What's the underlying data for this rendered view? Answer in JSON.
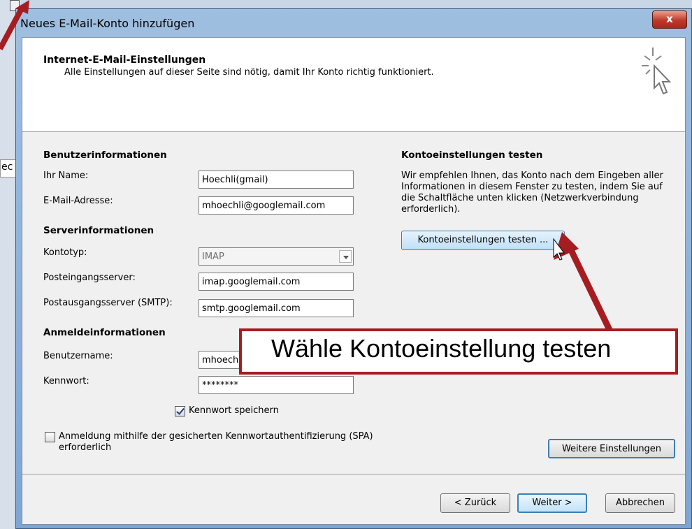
{
  "window": {
    "title": "Neues E-Mail-Konto hinzufügen",
    "close_label": "x"
  },
  "header": {
    "title": "Internet-E-Mail-Einstellungen",
    "subtitle": "Alle Einstellungen auf dieser Seite sind nötig, damit Ihr Konto richtig funktioniert."
  },
  "user": {
    "heading": "Benutzerinformationen",
    "name_label": "Ihr Name:",
    "name_value": "Hoechli(gmail)",
    "email_label": "E-Mail-Adresse:",
    "email_value": "mhoechli@googlemail.com"
  },
  "server": {
    "heading": "Serverinformationen",
    "type_label": "Kontotyp:",
    "type_value": "IMAP",
    "incoming_label": "Posteingangsserver:",
    "incoming_value": "imap.googlemail.com",
    "outgoing_label": "Postausgangsserver (SMTP):",
    "outgoing_value": "smtp.googlemail.com"
  },
  "login": {
    "heading": "Anmeldeinformationen",
    "username_label": "Benutzername:",
    "username_value": "mhoechli@",
    "password_label": "Kennwort:",
    "password_value": "********",
    "save_password_label": "Kennwort speichern",
    "spa_label": "Anmeldung mithilfe der gesicherten Kennwortauthentifizierung (SPA) erforderlich"
  },
  "test": {
    "heading": "Kontoeinstellungen testen",
    "text": "Wir empfehlen Ihnen, das Konto nach dem Eingeben aller Informationen in diesem Fenster zu testen, indem Sie auf die Schaltfläche unten klicken (Netzwerkverbindung erforderlich).",
    "button": "Kontoeinstellungen testen ..."
  },
  "more_settings": "Weitere Einstellungen",
  "footer": {
    "back": "< Zurück",
    "next": "Weiter >",
    "cancel": "Abbrechen"
  },
  "annotation": {
    "text": "Wähle Kontoeinstellung testen",
    "color": "#a51d21"
  },
  "background": {
    "fragment_1": "ec"
  }
}
